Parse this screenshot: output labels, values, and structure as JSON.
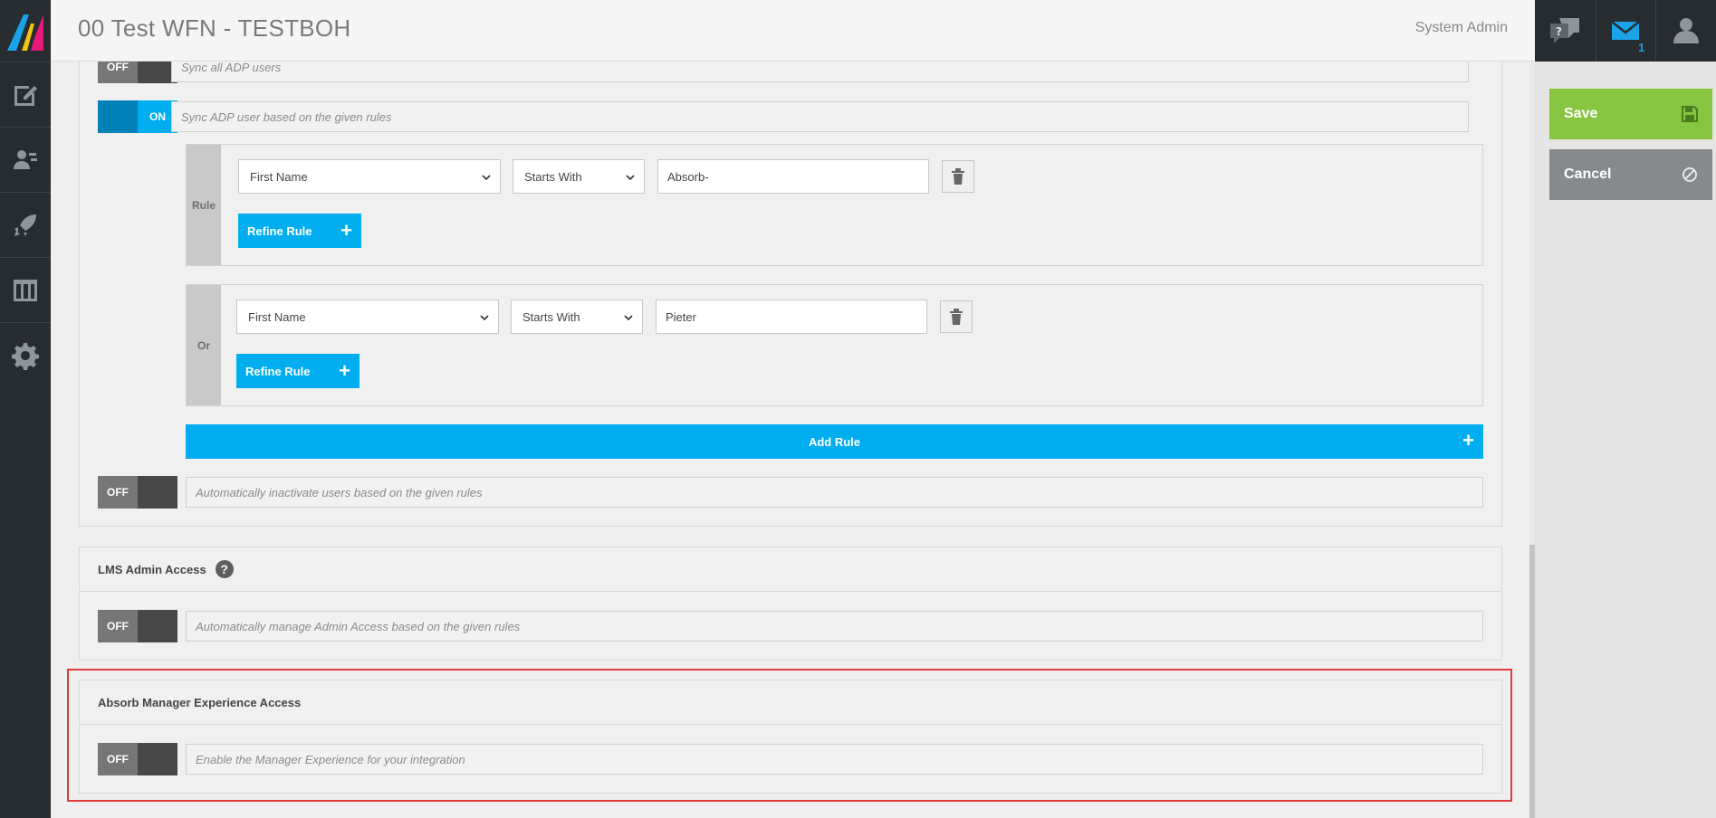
{
  "header": {
    "title": "00 Test WFN - TESTBOH",
    "user": "System Admin"
  },
  "notifications": {
    "message_count": "1"
  },
  "actions": {
    "save": "Save",
    "cancel": "Cancel"
  },
  "sync": {
    "sync_all": {
      "state": "OFF",
      "desc": "Sync all ADP users"
    },
    "sync_rules": {
      "state": "ON",
      "desc": "Sync ADP user based on the given rules",
      "rules": [
        {
          "label": "Rule",
          "field": "First Name",
          "operator": "Starts With",
          "value": "Absorb-",
          "refine": "Refine Rule"
        },
        {
          "label": "Or",
          "field": "First Name",
          "operator": "Starts With",
          "value": "Pieter",
          "refine": "Refine Rule"
        }
      ],
      "add_rule": "Add Rule"
    },
    "inactivate": {
      "state": "OFF",
      "desc": "Automatically inactivate users based on the given rules"
    }
  },
  "lms_admin": {
    "title": "LMS Admin Access",
    "help": "?",
    "state": "OFF",
    "desc": "Automatically manage Admin Access based on the given rules"
  },
  "manager_exp": {
    "title": "Absorb Manager Experience Access",
    "state": "OFF",
    "desc": "Enable the Manager Experience for your integration"
  },
  "colors": {
    "accent": "#00aeef",
    "save": "#87c540",
    "cancel": "#868a8d",
    "nav": "#272c30",
    "highlight": "#e03a3a"
  }
}
